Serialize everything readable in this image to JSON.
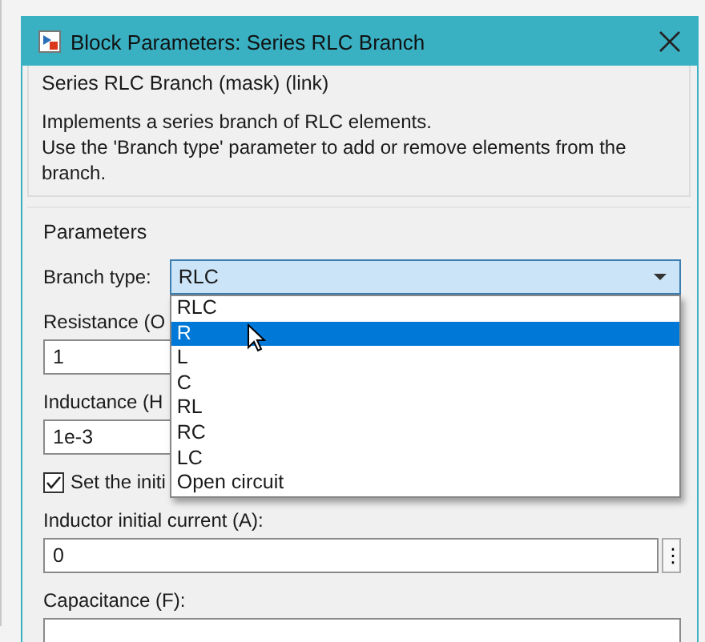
{
  "window": {
    "title": "Block Parameters: Series RLC Branch"
  },
  "description": {
    "legend": "Series RLC Branch (mask) (link)",
    "paragraphs": [
      "Implements a series branch of RLC elements.",
      "Use the 'Branch type' parameter to add or remove elements from the branch."
    ]
  },
  "parameters": {
    "legend": "Parameters",
    "fields": [
      {
        "kind": "dropdown",
        "label": "Branch type:",
        "value": "RLC",
        "expanded": true,
        "options": [
          {
            "label": "RLC",
            "highlighted": false
          },
          {
            "label": "R",
            "highlighted": true
          },
          {
            "label": "L",
            "highlighted": false
          },
          {
            "label": "C",
            "highlighted": false
          },
          {
            "label": "RL",
            "highlighted": false
          },
          {
            "label": "RC",
            "highlighted": false
          },
          {
            "label": "LC",
            "highlighted": false
          },
          {
            "label": "Open circuit",
            "highlighted": false
          }
        ]
      },
      {
        "kind": "text",
        "label": "Resistance (O",
        "value": "1"
      },
      {
        "kind": "text",
        "label": "Inductance (H",
        "value": "1e-3"
      },
      {
        "kind": "checkbox",
        "label": "Set the initi",
        "checked": true
      },
      {
        "kind": "text",
        "label": "Inductor initial current (A):",
        "value": "0",
        "more_button": "⋮"
      },
      {
        "kind": "text",
        "label": "Capacitance (F):"
      }
    ]
  }
}
